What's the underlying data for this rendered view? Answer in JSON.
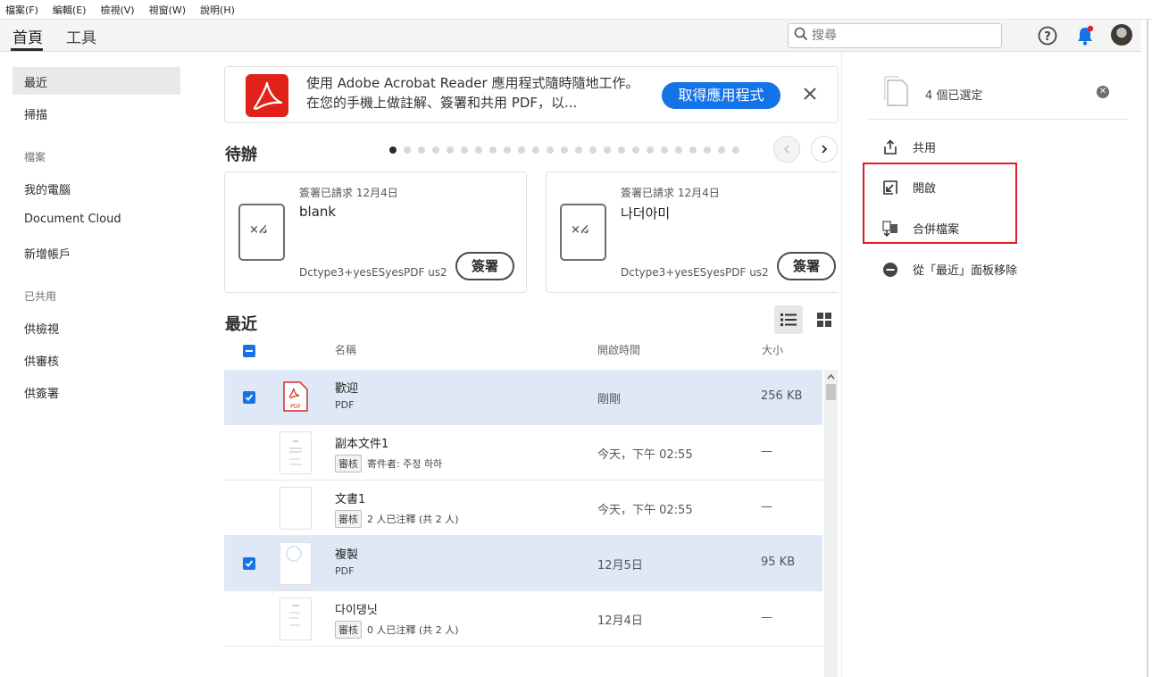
{
  "menubar": [
    "檔案(F)",
    "編輯(E)",
    "檢視(V)",
    "視窗(W)",
    "說明(H)"
  ],
  "nav": {
    "tabs": [
      "首頁",
      "工具"
    ],
    "search_placeholder": "搜尋"
  },
  "sidebar": {
    "items_top": [
      "最近",
      "掃描"
    ],
    "files_head": "檔案",
    "files_items": [
      "我的電腦",
      "Document Cloud",
      "新增帳戶"
    ],
    "shared_head": "已共用",
    "shared_items": [
      "供檢視",
      "供審核",
      "供簽署"
    ]
  },
  "banner": {
    "text": "使用 Adobe Acrobat Reader 應用程式隨時隨地工作。在您的手機上做註解、簽署和共用 PDF，以...",
    "button": "取得應用程式"
  },
  "todo": {
    "title": "待辦",
    "cards": [
      {
        "status": "簽署已請求 12月4日",
        "name": "blank",
        "sender": "Dctype3+yesESyesPDF us2",
        "button": "簽署"
      },
      {
        "status": "簽署已請求 12月4日",
        "name": "나더아미",
        "sender": "Dctype3+yesESyesPDF us2",
        "button": "簽署"
      }
    ]
  },
  "recent": {
    "title": "最近",
    "columns": {
      "name": "名稱",
      "time": "開啟時間",
      "size": "大小"
    },
    "rows": [
      {
        "name": "歡迎",
        "sub": "PDF",
        "badge": "",
        "time": "剛剛",
        "size": "256 KB",
        "selected": true
      },
      {
        "name": "副本文件1",
        "sub": "寄件者: 주정 하하",
        "badge": "審核",
        "time": "今天，下午 02:55",
        "size": "—",
        "selected": false
      },
      {
        "name": "文書1",
        "sub": "2 人已注釋 (共 2 人)",
        "badge": "審核",
        "time": "今天，下午 02:55",
        "size": "—",
        "selected": false
      },
      {
        "name": "複製",
        "sub": "PDF",
        "badge": "",
        "time": "12月5日",
        "size": "95 KB",
        "selected": true
      },
      {
        "name": "다이댕닛",
        "sub": "0 人已注釋 (共 2 人)",
        "badge": "審核",
        "time": "12月4日",
        "size": "—",
        "selected": false
      }
    ]
  },
  "panel": {
    "count": "4 個已選定",
    "actions": [
      "共用",
      "開啟",
      "合併檔案",
      "從「最近」面板移除"
    ]
  },
  "colors": {
    "accent": "#1473e6",
    "acrobat_red": "#e0221b",
    "highlight_box": "#e01c24",
    "selected_row": "#dfe8f6"
  }
}
